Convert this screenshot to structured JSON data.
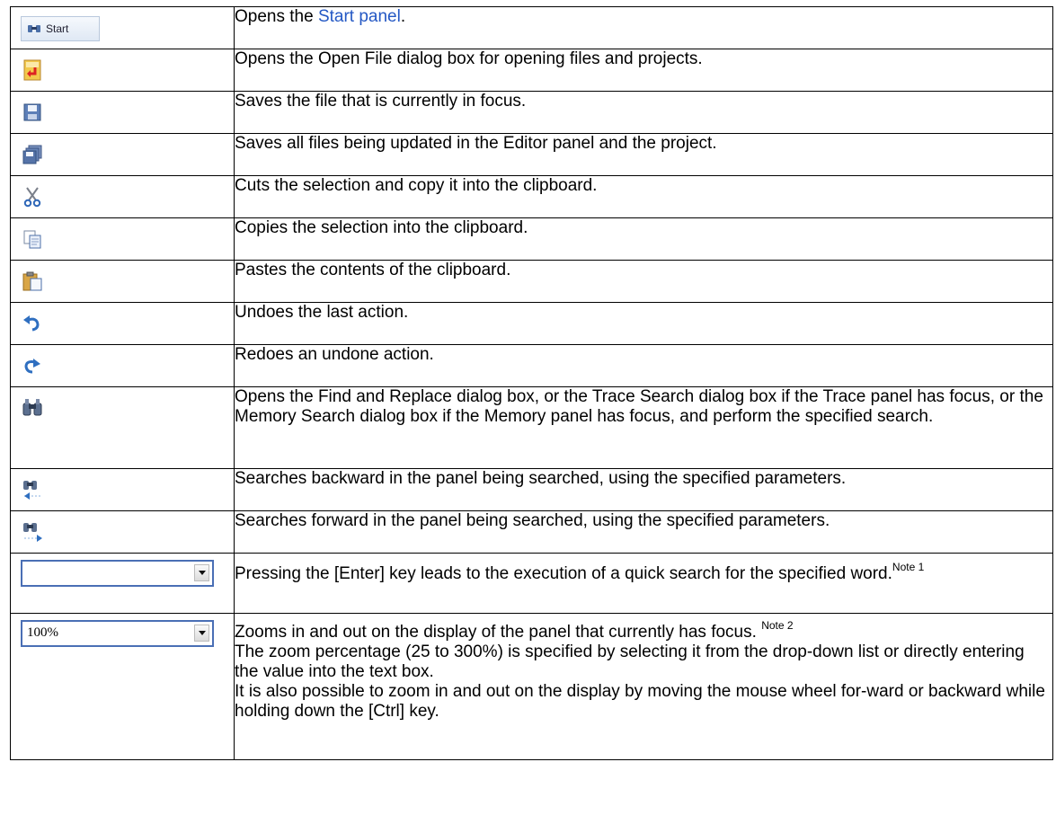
{
  "rows": [
    {
      "icon": "start-button-icon",
      "button_text": "Start",
      "pre": "Opens the ",
      "link": "Start panel",
      "post": "."
    },
    {
      "icon": "open-file-icon",
      "text": "Opens the Open File dialog box for opening files and projects."
    },
    {
      "icon": "save-icon",
      "text": "Saves the file that is currently in focus."
    },
    {
      "icon": "save-all-icon",
      "text": "Saves all files being updated in the Editor panel and the project."
    },
    {
      "icon": "cut-icon",
      "text": "Cuts the selection and copy it into the clipboard."
    },
    {
      "icon": "copy-icon",
      "text": "Copies the selection into the clipboard."
    },
    {
      "icon": "paste-icon",
      "text": "Pastes the contents of the clipboard."
    },
    {
      "icon": "undo-icon",
      "text": "Undoes the last action."
    },
    {
      "icon": "redo-icon",
      "text": "Redoes an undone action."
    },
    {
      "icon": "find-replace-icon",
      "text": "Opens the Find and Replace dialog box, or the Trace Search dialog box if the Trace panel has focus, or the Memory Search dialog box if the Memory panel has focus, and perform the specified search."
    },
    {
      "icon": "search-backward-icon",
      "text": "Searches backward in the panel being searched, using the specified parameters."
    },
    {
      "icon": "search-forward-icon",
      "text": "Searches forward in the panel being searched, using the specified parameters."
    },
    {
      "icon": "quick-search-combo",
      "combo_value": "",
      "text": "Pressing the [Enter] key leads to the execution of a quick search for the specified word.",
      "note": "Note 1"
    },
    {
      "icon": "zoom-combo",
      "combo_value": "100%",
      "text1": "Zooms in and out on the display of the panel that currently has focus. ",
      "note": "Note 2",
      "text2": "The zoom percentage (25 to 300%) is specified by selecting it from the drop-down list or directly entering the value into the text box.",
      "text3": "It is also possible to zoom in and out on the display by moving the mouse wheel for-ward or backward while holding down the [Ctrl] key."
    }
  ]
}
